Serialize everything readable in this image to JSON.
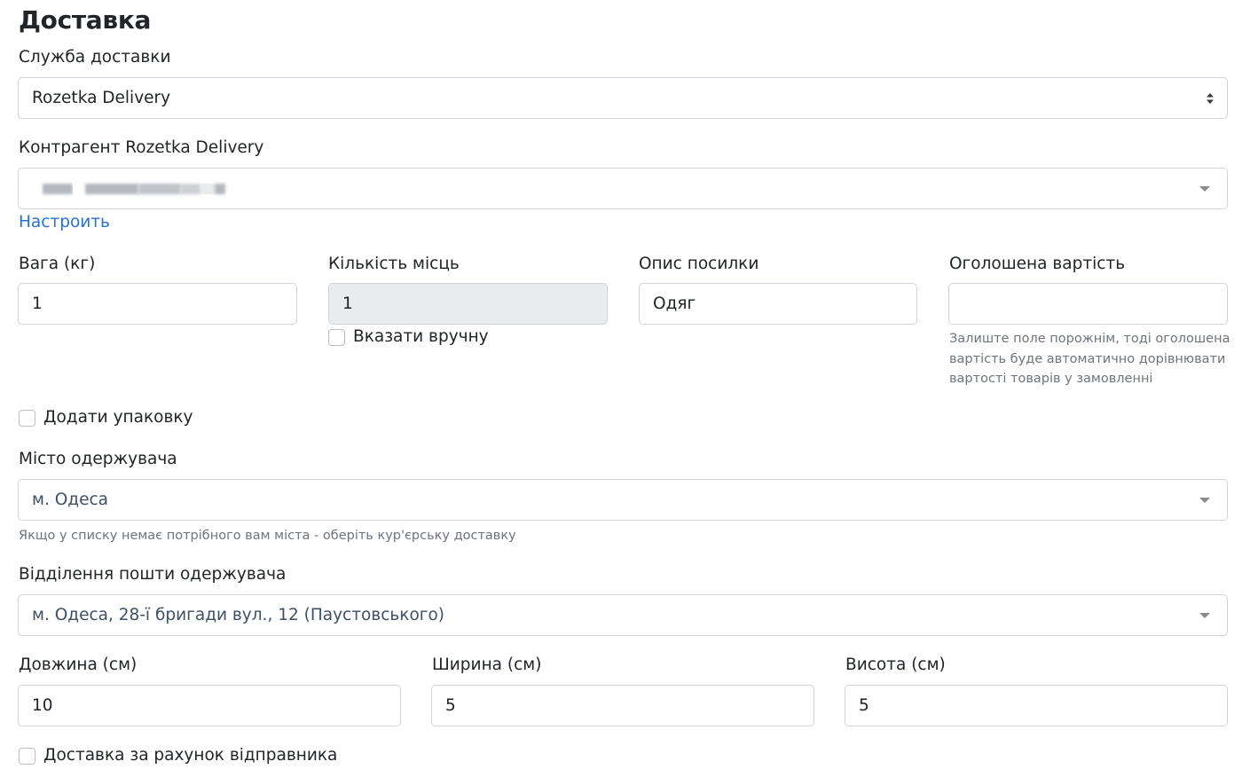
{
  "section": {
    "title": "Доставка"
  },
  "service": {
    "label": "Служба доставки",
    "value": "Rozetka Delivery"
  },
  "counterparty": {
    "label": "Контрагент Rozetka Delivery",
    "configure_link": "Настроить"
  },
  "weight": {
    "label": "Вага (кг)",
    "value": "1"
  },
  "places": {
    "label": "Кількість місць",
    "value": "1",
    "manual_label": "Вказати вручну"
  },
  "description": {
    "label": "Опис посилки",
    "value": "Одяг"
  },
  "declared": {
    "label": "Оголошена вартість",
    "value": "",
    "help_lines": [
      "Залиште поле порожнім, тоді оголошена",
      "вартість буде автоматично дорівнювати",
      "вартості товарів у замовленні"
    ]
  },
  "packaging": {
    "label": "Додати упаковку"
  },
  "city": {
    "label": "Місто одержувача",
    "value": "м. Одеса",
    "help": "Якщо у списку немає потрібного вам міста - оберіть кур'єрську доставку"
  },
  "branch": {
    "label": "Відділення пошти одержувача",
    "value": "м. Одеса, 28-ї бригади вул., 12 (Паустовського)"
  },
  "length": {
    "label": "Довжина (см)",
    "value": "10"
  },
  "width": {
    "label": "Ширина (см)",
    "value": "5"
  },
  "height": {
    "label": "Висота (см)",
    "value": "5"
  },
  "sender_pays": {
    "label": "Доставка за рахунок відправника"
  },
  "icons": {
    "select_arrows": "sort-arrows-icon",
    "dropdown_caret": "caret-down-icon",
    "checkbox": "checkbox-unchecked-icon"
  },
  "colors": {
    "link": "#2a6fd6",
    "border": "#ced4da",
    "disabled_bg": "#e9ecef",
    "help_text": "#6c757d"
  }
}
